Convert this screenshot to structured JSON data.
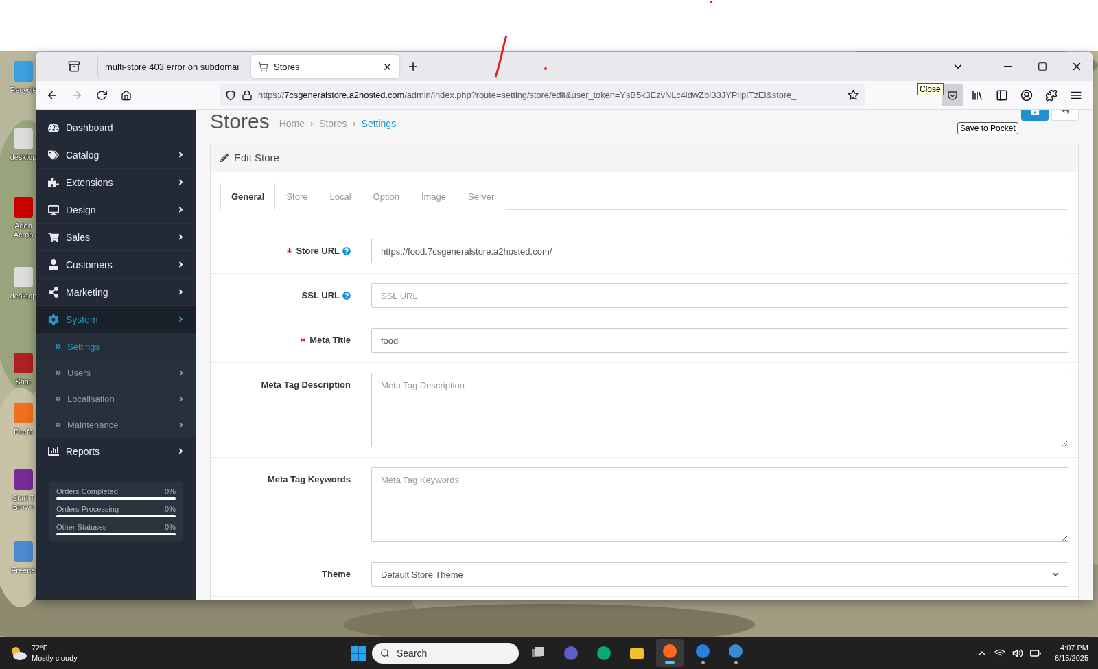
{
  "desktop_icons": [
    {
      "lines": [
        "Recycle"
      ]
    },
    {
      "lines": [
        "desktop"
      ]
    },
    {
      "lines": [
        "Adob",
        "Acrob"
      ]
    },
    {
      "lines": [
        "desktop"
      ]
    },
    {
      "lines": [
        "Shar"
      ]
    },
    {
      "lines": [
        "Firefo"
      ]
    },
    {
      "lines": [
        "Start T",
        "Brows"
      ]
    },
    {
      "lines": [
        "Freene"
      ]
    }
  ],
  "browser": {
    "tabs": [
      {
        "title": "multi-store 403 error on subdomai",
        "selected": false
      },
      {
        "title": "Stores",
        "selected": true
      }
    ],
    "url": {
      "scheme": "https://",
      "host": "7csgeneralstore.a2hosted.com",
      "path": "/admin/index.php?route=setting/store/edit&user_token=YsB5k3EzvNLc4ldwZbI33JYPilpITzEi&store_"
    },
    "tooltips": [
      "Close",
      "Save to Pocket"
    ]
  },
  "sidebar": {
    "items": [
      {
        "label": "Dashboard",
        "selected": false,
        "expandable": false
      },
      {
        "label": "Catalog",
        "selected": false,
        "expandable": true
      },
      {
        "label": "Extensions",
        "selected": false,
        "expandable": true
      },
      {
        "label": "Design",
        "selected": false,
        "expandable": true
      },
      {
        "label": "Sales",
        "selected": false,
        "expandable": true
      },
      {
        "label": "Customers",
        "selected": false,
        "expandable": true
      },
      {
        "label": "Marketing",
        "selected": false,
        "expandable": true
      },
      {
        "label": "System",
        "selected": true,
        "expandable": true,
        "children": [
          {
            "label": "Settings",
            "selected": true,
            "expandable": false
          },
          {
            "label": "Users",
            "selected": false,
            "expandable": true
          },
          {
            "label": "Localisation",
            "selected": false,
            "expandable": true
          },
          {
            "label": "Maintenance",
            "selected": false,
            "expandable": true
          }
        ]
      },
      {
        "label": "Reports",
        "selected": false,
        "expandable": true
      }
    ],
    "order_stats": [
      {
        "label": "Orders Completed",
        "value": "0%",
        "level": 0
      },
      {
        "label": "Orders Processing",
        "value": "0%",
        "level": 0
      },
      {
        "label": "Other Statuses",
        "value": "0%",
        "level": 0
      }
    ]
  },
  "page": {
    "title": "Stores",
    "breadcrumb": [
      {
        "label": "Home",
        "selected": false
      },
      {
        "label": "Stores",
        "selected": false
      },
      {
        "label": "Settings",
        "selected": true
      }
    ],
    "panel_title": "Edit Store",
    "tabs": [
      {
        "label": "General",
        "selected": true
      },
      {
        "label": "Store",
        "selected": false
      },
      {
        "label": "Local",
        "selected": false
      },
      {
        "label": "Option",
        "selected": false
      },
      {
        "label": "Image",
        "selected": false
      },
      {
        "label": "Server",
        "selected": false
      }
    ],
    "fields": [
      {
        "label": "Store URL",
        "required": true,
        "help": true,
        "kind": "text",
        "value": "https://food.7csgeneralstore.a2hosted.com/"
      },
      {
        "label": "SSL URL",
        "required": false,
        "help": true,
        "kind": "text",
        "placeholder": "SSL URL"
      },
      {
        "label": "Meta Title",
        "required": true,
        "help": false,
        "kind": "text",
        "value": "food"
      },
      {
        "label": "Meta Tag Description",
        "required": false,
        "help": false,
        "kind": "textarea",
        "placeholder": "Meta Tag Description"
      },
      {
        "label": "Meta Tag Keywords",
        "required": false,
        "help": false,
        "kind": "textarea",
        "placeholder": "Meta Tag Keywords"
      },
      {
        "label": "Theme",
        "required": false,
        "help": false,
        "kind": "select",
        "value": "Default Store Theme"
      }
    ]
  },
  "taskbar": {
    "temperature": "72°F",
    "weather": "Mostly cloudy",
    "search_placeholder": "Search",
    "apps": [
      {
        "selected": false,
        "running": false
      },
      {
        "selected": false,
        "running": false
      },
      {
        "selected": false,
        "running": false
      },
      {
        "selected": false,
        "running": false
      },
      {
        "selected": true,
        "running": true
      },
      {
        "selected": false,
        "running": true
      },
      {
        "selected": false,
        "running": true
      }
    ],
    "time": "4:07 PM",
    "date": "6/15/2025"
  }
}
